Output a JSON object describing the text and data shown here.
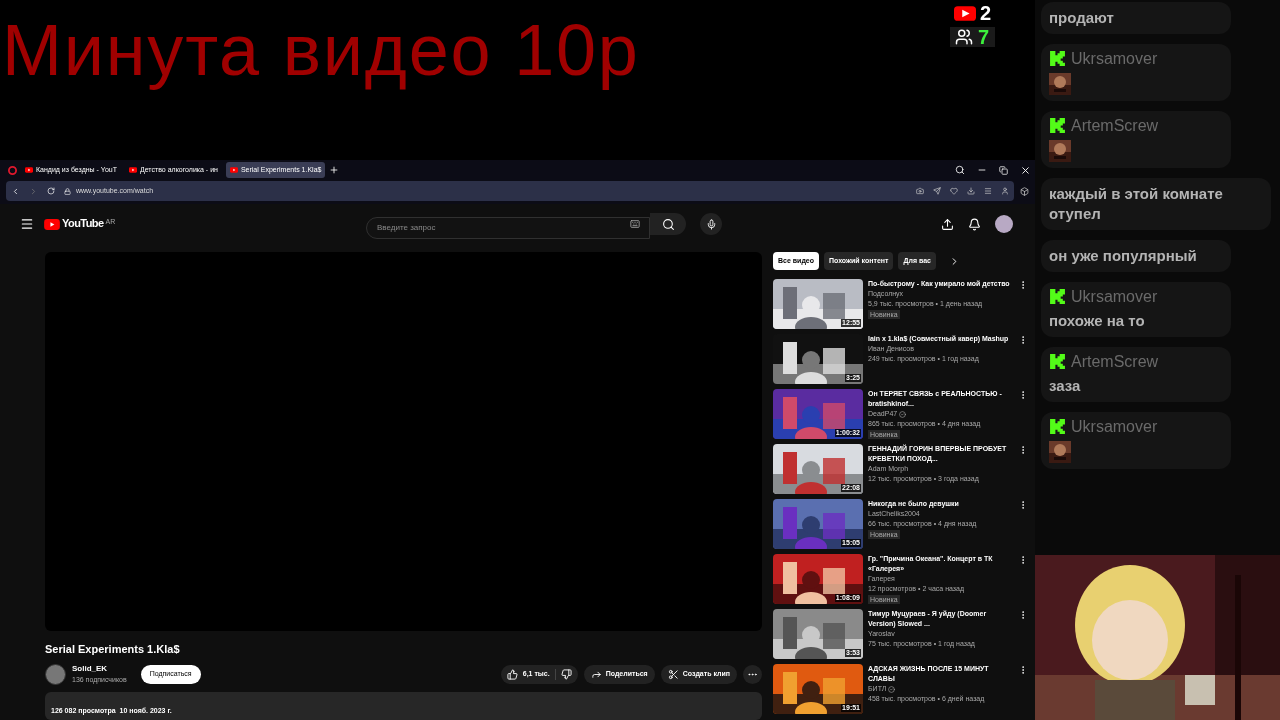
{
  "overlay": {
    "headline": "Минута видео 10р",
    "counters": [
      {
        "kind": "youtube",
        "value": "2"
      },
      {
        "kind": "viewers",
        "value": "7"
      }
    ]
  },
  "browser": {
    "tabs": [
      {
        "label": "Кандид из бездны - YouT",
        "selected": false
      },
      {
        "label": "Детство алкоголика - ин",
        "selected": false
      },
      {
        "label": "Serial Experiments 1.Kla$",
        "selected": true
      }
    ],
    "url": "www.youtube.com/watch"
  },
  "youtube": {
    "logo": "YouTube",
    "region": "AR",
    "search": {
      "placeholder": "Введите запрос"
    },
    "chips": [
      {
        "label": "Все видео",
        "selected": true
      },
      {
        "label": "Похожий контент",
        "selected": false
      },
      {
        "label": "Для вас",
        "selected": false
      }
    ],
    "video": {
      "title": "Serial Experiments 1.Kla$",
      "channel": "Solid_EK",
      "subscribers": "136 подписчиков",
      "subscribe": "Подписаться",
      "likes": "6,1 тыс.",
      "share": "Поделиться",
      "clip": "Создать клип",
      "stats": "126 082 просмотра  10 нояб. 2023 г."
    },
    "recommendations": [
      {
        "title": "По-быстрому - Как умирало мой детство",
        "channel": "Подсолнух",
        "verified": false,
        "meta": "5,9 тыс. просмотров • 1 день назад",
        "duration": "12:55",
        "badge": "Новинка"
      },
      {
        "title": "lain x 1.kla$ (Совместный кавер) Mashup",
        "channel": "Иван Денисов",
        "verified": false,
        "meta": "249 тыс. просмотров • 1 год назад",
        "duration": "3:25"
      },
      {
        "title": "Он ТЕРЯЕТ СВЯЗЬ с РЕАЛЬНОСТЬЮ - bratishkinof...",
        "channel": "DeadP47",
        "verified": true,
        "meta": "865 тыс. просмотров • 4 дня назад",
        "duration": "1:00:32",
        "badge": "Новинка"
      },
      {
        "title": "ГЕННАДИЙ ГОРИН ВПЕРВЫЕ ПРОБУЕТ КРЕВЕТКИ  ПОХОД...",
        "channel": "Adam Morph",
        "verified": false,
        "meta": "12 тыс. просмотров • 3 года назад",
        "duration": "22:08"
      },
      {
        "title": "Никогда не было девушки",
        "channel": "LastCheliks2004",
        "verified": false,
        "meta": "66 тыс. просмотров • 4 дня назад",
        "duration": "15:05",
        "badge": "Новинка"
      },
      {
        "title": "Гр. \"Причина Океана\". Концерт в ТК «Галерея»",
        "channel": "Галерея",
        "verified": false,
        "meta": "12 просмотров • 2 часа назад",
        "duration": "1:08:09",
        "badge": "Новинка"
      },
      {
        "title": "Тимур Муцураев - Я уйду (Doomer Version) Slowed ...",
        "channel": "Yaroslav",
        "verified": false,
        "meta": "75 тыс. просмотров • 1 год назад",
        "duration": "3:53"
      },
      {
        "title": "АДСКАЯ ЖИЗНЬ ПОСЛЕ 15 МИНУТ СЛАВЫ",
        "channel": "БИТЛ",
        "verified": true,
        "meta": "458 тыс. просмотров • 6 дней назад",
        "duration": "19:51"
      }
    ]
  },
  "chat": {
    "messages": [
      {
        "kind": "text",
        "text": "продают"
      },
      {
        "kind": "emote",
        "user": "Ukrsamover"
      },
      {
        "kind": "emote",
        "user": "ArtemScrew"
      },
      {
        "kind": "text",
        "text": "каждый в этой комнате отупел"
      },
      {
        "kind": "text",
        "text": "он уже популярный"
      },
      {
        "kind": "text",
        "user": "Ukrsamover",
        "text": "похоже на то"
      },
      {
        "kind": "text",
        "user": "ArtemScrew",
        "text": "заза"
      },
      {
        "kind": "emote",
        "user": "Ukrsamover"
      }
    ]
  }
}
